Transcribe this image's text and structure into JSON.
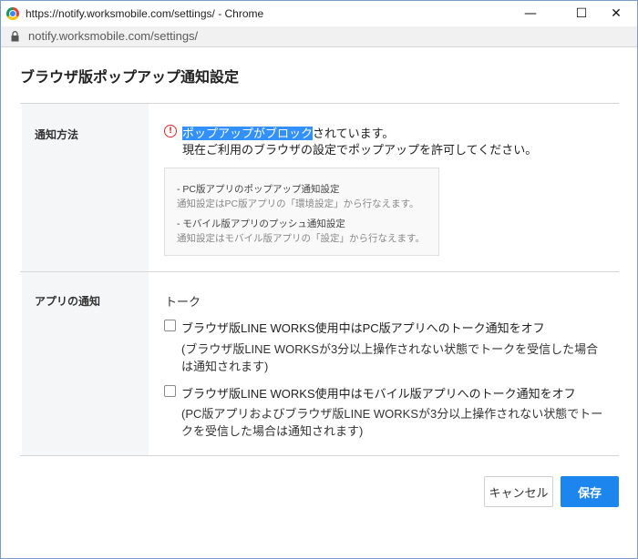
{
  "window": {
    "title": "https://notify.worksmobile.com/settings/ - Chrome",
    "url": "notify.worksmobile.com/settings/",
    "controls": {
      "minimize": "—",
      "maximize": "☐",
      "close": "✕"
    }
  },
  "dialog": {
    "title": "ブラウザ版ポップアップ通知設定",
    "method": {
      "label": "通知方法",
      "warning_highlight": "ポップアップがブロック",
      "warning_rest": "されています。",
      "warning_line2": "現在ご利用のブラウザの設定でポップアップを許可してください。",
      "info": [
        {
          "title": "- PC版アプリのポップアップ通知設定",
          "desc": "通知設定はPC版アプリの「環境設定」から行なえます。"
        },
        {
          "title": "- モバイル版アプリのプッシュ通知設定",
          "desc": "通知設定はモバイル版アプリの「設定」から行なえます。"
        }
      ]
    },
    "app_notify": {
      "label": "アプリの通知",
      "section": "トーク",
      "options": [
        {
          "label": "ブラウザ版LINE WORKS使用中はPC版アプリへのトーク通知をオフ",
          "note": "(ブラウザ版LINE WORKSが3分以上操作されない状態でトークを受信した場合は通知されます)",
          "checked": false
        },
        {
          "label": "ブラウザ版LINE WORKS使用中はモバイル版アプリへのトーク通知をオフ",
          "note": "(PC版アプリおよびブラウザ版LINE WORKSが3分以上操作されない状態でトークを受信した場合は通知されます)",
          "checked": false
        }
      ]
    },
    "buttons": {
      "cancel": "キャンセル",
      "save": "保存"
    }
  },
  "colors": {
    "accent": "#1c86ee",
    "warning": "#e02b2b",
    "highlight": "#3390ff"
  }
}
